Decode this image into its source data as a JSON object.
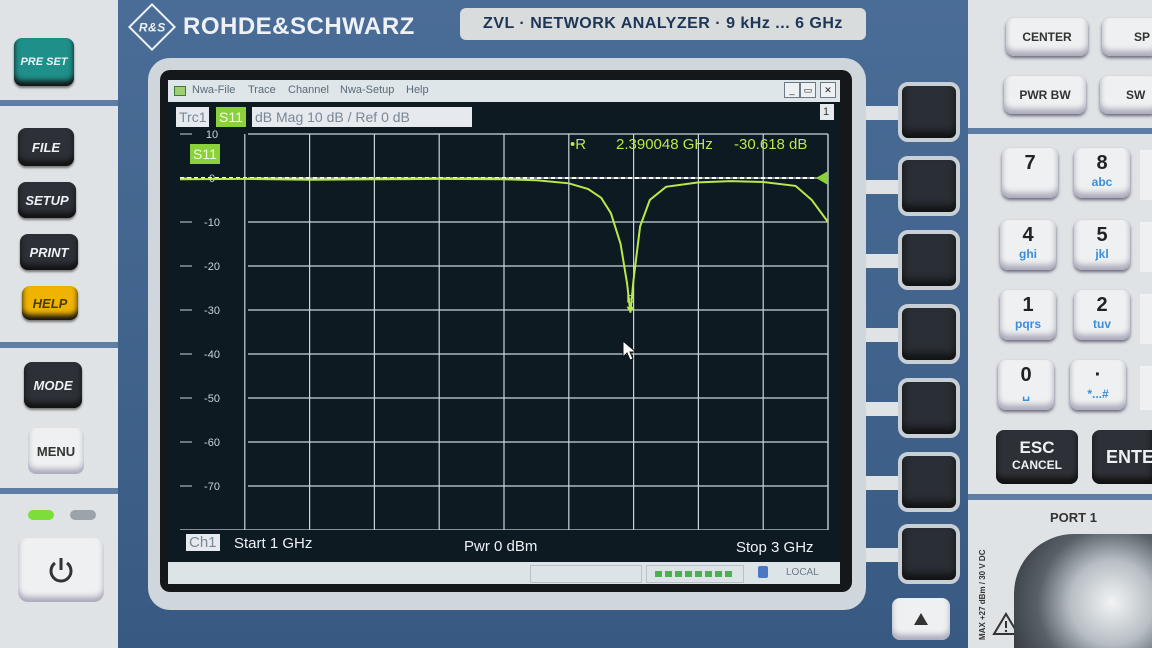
{
  "brand": {
    "name": "ROHDE&SCHWARZ",
    "logo_letters": "R&S"
  },
  "model_label": "ZVL · NETWORK ANALYZER · 9 kHz ... 6 GHz",
  "left_keys": {
    "preset": "PRE SET",
    "file": "FILE",
    "setup": "SETUP",
    "print": "PRINT",
    "help": "HELP",
    "mode": "MODE",
    "menu": "MENU"
  },
  "menu": {
    "items": [
      "Nwa-File",
      "Trace",
      "Channel",
      "Nwa-Setup",
      "Help"
    ],
    "win_buttons": [
      "_",
      "▭",
      "✕"
    ],
    "scroll_indicator": "1"
  },
  "trace": {
    "name": "Trc1",
    "param": "S11",
    "format": "dB Mag  10 dB /  Ref 0 dB",
    "label": "S11"
  },
  "marker": {
    "symbol": "•R",
    "freq": "2.390048 GHz",
    "value": "-30.618 dB",
    "tag": "R"
  },
  "status": {
    "channel": "Ch1",
    "start": "Start  1 GHz",
    "power": "Pwr  0 dBm",
    "stop": "Stop  3 GHz",
    "local": "LOCAL"
  },
  "right_keys": {
    "center": "CENTER",
    "span": "SP",
    "pwr_bw": "PWR BW",
    "sweep": "SW",
    "esc": "ESC",
    "cancel": "CANCEL",
    "enter": "ENTE",
    "port": "PORT 1",
    "port_rating": "MAX +27 dBm / 30 V DC"
  },
  "keypad": [
    {
      "n": "7",
      "s": ""
    },
    {
      "n": "8",
      "s": "abc"
    },
    {
      "n": "4",
      "s": "ghi"
    },
    {
      "n": "5",
      "s": "jkl"
    },
    {
      "n": "1",
      "s": "pqrs"
    },
    {
      "n": "2",
      "s": "tuv"
    },
    {
      "n": "0",
      "s": "␣"
    },
    {
      "n": "·",
      "s": "*...#"
    }
  ],
  "colors": {
    "trace": "#b8e84a",
    "grid": "#c9d3da",
    "screen": "#0e1a22",
    "ref_line": "#ffffff",
    "help_key": "#f0b400",
    "preset_key": "#1f8f8a"
  },
  "chart_data": {
    "type": "line",
    "title": "",
    "xlabel": "",
    "ylabel": "dB Mag",
    "xlim": [
      1,
      3
    ],
    "ylim": [
      -80,
      10
    ],
    "yticks": [
      10,
      0,
      -10,
      -20,
      -30,
      -40,
      -50,
      -60,
      -70
    ],
    "x_divisions": 10,
    "grid": true,
    "reference_level": 0,
    "series": [
      {
        "name": "S11",
        "x": [
          1.0,
          1.2,
          1.4,
          1.6,
          1.8,
          2.0,
          2.1,
          2.2,
          2.26,
          2.3,
          2.33,
          2.36,
          2.38,
          2.39,
          2.4,
          2.42,
          2.45,
          2.5,
          2.6,
          2.7,
          2.8,
          2.9,
          2.95,
          3.0
        ],
        "y": [
          -0.3,
          -0.2,
          -0.4,
          -0.3,
          -0.2,
          -0.3,
          -0.5,
          -1.2,
          -2.5,
          -4.5,
          -8.0,
          -15.0,
          -24.0,
          -30.6,
          -23.0,
          -11.0,
          -5.0,
          -2.0,
          -1.0,
          -0.7,
          -0.9,
          -1.8,
          -5.0,
          -10.0
        ]
      }
    ],
    "marker": {
      "x": 2.390048,
      "y": -30.618
    }
  }
}
